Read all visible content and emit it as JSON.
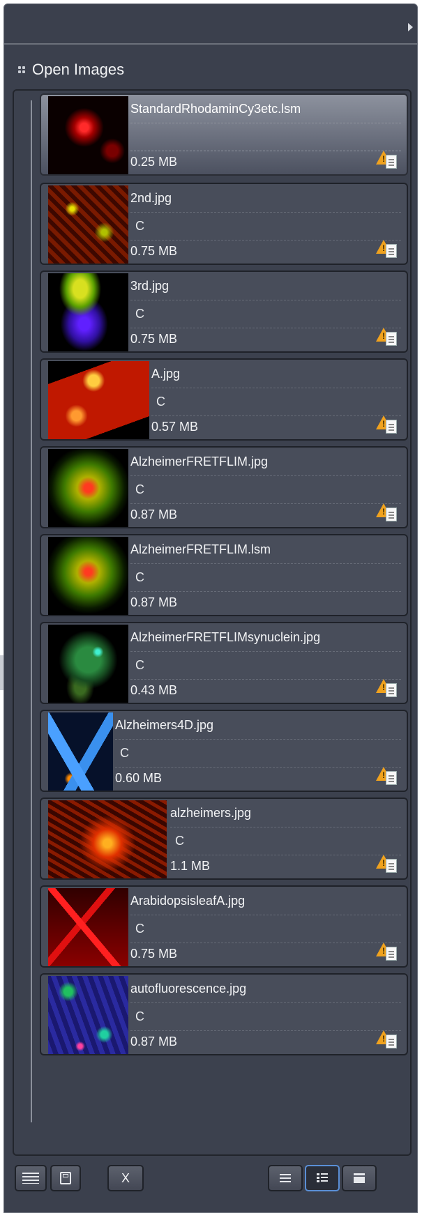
{
  "panel": {
    "section_title": "Open Images"
  },
  "colors": {
    "panel_bg": "#3b404d",
    "item_bg": "#484d5a",
    "warning": "#f0a21e",
    "active_view_border": "#5a8fd6"
  },
  "images": [
    {
      "name": "StandardRhodaminCy3etc.lsm",
      "channel": "",
      "size": "0.25 MB",
      "selected": true,
      "status_icon": "warning-document-icon"
    },
    {
      "name": "2nd.jpg",
      "channel": "C",
      "size": "0.75 MB",
      "status_icon": "warning-document-icon"
    },
    {
      "name": "3rd.jpg",
      "channel": "C",
      "size": "0.75 MB",
      "status_icon": "warning-document-icon"
    },
    {
      "name": "A.jpg",
      "channel": "C",
      "size": "0.57 MB",
      "status_icon": "warning-document-icon"
    },
    {
      "name": "AlzheimerFRETFLIM.jpg",
      "channel": "C",
      "size": "0.87 MB",
      "status_icon": "warning-document-icon"
    },
    {
      "name": "AlzheimerFRETFLIM.lsm",
      "channel": "C",
      "size": "0.87 MB",
      "status_icon": ""
    },
    {
      "name": "AlzheimerFRETFLIMsynuclein.jpg",
      "channel": "C",
      "size": "0.43 MB",
      "status_icon": "warning-document-icon"
    },
    {
      "name": "Alzheimers4D.jpg",
      "channel": "C",
      "size": "0.60 MB",
      "status_icon": "warning-document-icon"
    },
    {
      "name": "alzheimers.jpg",
      "channel": "C",
      "size": "1.1 MB",
      "status_icon": "warning-document-icon"
    },
    {
      "name": "ArabidopsisleafA.jpg",
      "channel": "C",
      "size": "0.75 MB",
      "status_icon": "warning-document-icon"
    },
    {
      "name": "autofluorescence.jpg",
      "channel": "C",
      "size": "0.87 MB",
      "status_icon": "warning-document-icon"
    }
  ],
  "toolbar": {
    "close_label": "X",
    "buttons": [
      "list-view-icon",
      "save-icon",
      "close-icon",
      "list-view-icon",
      "detail-view-icon",
      "compact-view-icon"
    ],
    "active_view": "detail-view-icon"
  }
}
